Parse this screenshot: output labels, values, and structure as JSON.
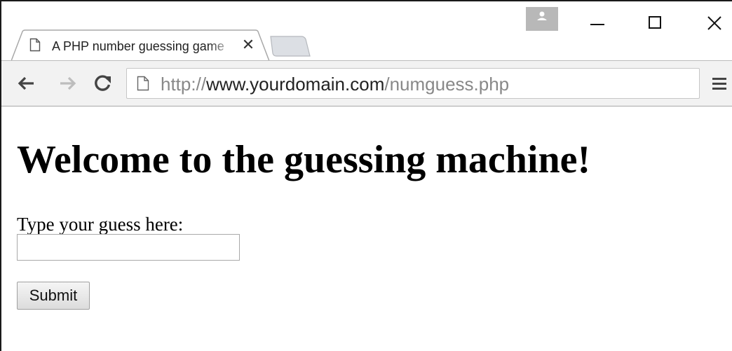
{
  "browser": {
    "tab": {
      "title": "A PHP number guessing game",
      "close_glyph": "✕",
      "favicon_icon": "page-icon"
    },
    "window_controls": {
      "profile_icon": "person-icon",
      "minimize_icon": "minimize-icon",
      "maximize_icon": "maximize-icon",
      "close_icon": "close-icon"
    },
    "toolbar": {
      "back_icon": "arrow-left-icon",
      "forward_icon": "arrow-right-icon",
      "reload_icon": "reload-icon",
      "menu_icon": "hamburger-menu-icon"
    },
    "omnibox": {
      "scheme": "http://",
      "host": "www.yourdomain.com",
      "path": "/numguess.php",
      "icon": "page-icon"
    }
  },
  "page": {
    "heading": "Welcome to the guessing machine!",
    "form": {
      "label": "Type your guess here:",
      "input_value": "",
      "submit_label": "Submit"
    }
  },
  "colors": {
    "toolbar_bg": "#f2f2f2",
    "profile_button": "#b8b8b8",
    "url_dim": "#888888",
    "url_host": "#222222"
  }
}
